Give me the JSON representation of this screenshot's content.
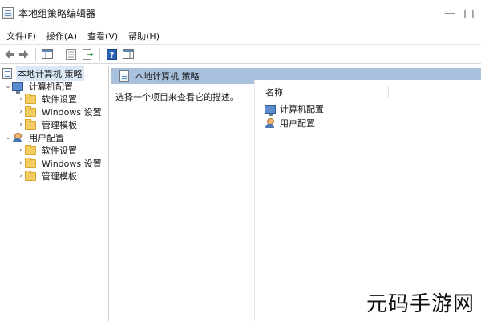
{
  "window": {
    "title": "本地组策略编辑器",
    "controls": {
      "minimize": "—",
      "maximize": "□",
      "close": "×"
    }
  },
  "menu": [
    "文件(F)",
    "操作(A)",
    "查看(V)",
    "帮助(H)"
  ],
  "toolbar": {
    "back_icon": "arrow-left-icon",
    "forward_icon": "arrow-right-icon",
    "icons": [
      "show-hide-console-tree-icon",
      "properties-icon",
      "export-list-icon",
      "help-icon",
      "show-action-pane-icon"
    ]
  },
  "tree": {
    "root": "本地计算机 策略",
    "computer": "计算机配置",
    "computer_children": [
      "软件设置",
      "Windows 设置",
      "管理模板"
    ],
    "user": "用户配置",
    "user_children": [
      "软件设置",
      "Windows 设置",
      "管理模板"
    ]
  },
  "content": {
    "header_title": "本地计算机 策略",
    "description": "选择一个项目来查看它的描述。",
    "column_name": "名称",
    "items": [
      "计算机配置",
      "用户配置"
    ]
  },
  "watermark": "元码手游网",
  "colors": {
    "header_bg": "#a8c1dc",
    "selection_bg": "#d9e7f7",
    "folder": "#f3cd62"
  }
}
